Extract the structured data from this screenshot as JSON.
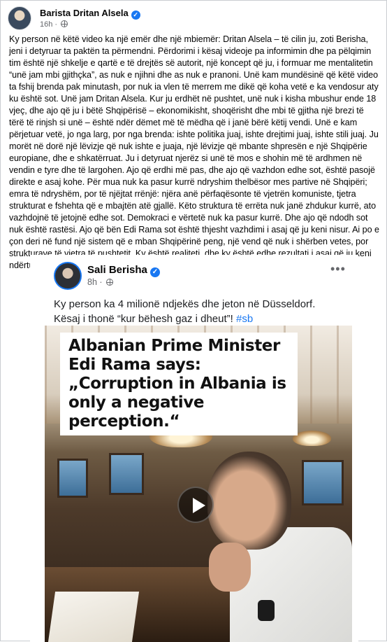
{
  "post": {
    "author": "Barista Dritan Alsela",
    "time": "16h",
    "separator": "·",
    "text": "Ky person në këtë video ka një emër dhe një mbiemër: Dritan Alsela – të cilin ju, zoti Berisha, jeni i detyruar ta paktën ta përmendni. Përdorimi i kësaj videoje pa informimin dhe pa pëlqimin tim është një shkelje e qartë e të drejtës së autorit, një koncept që ju, i formuar me mentalitetin “unë jam mbi gjithçka”, as nuk e njihni dhe as nuk e pranoni. Unë kam mundësinë që këtë video ta fshij brenda pak minutash, por nuk ia vlen të merrem me dikë që koha vetë e ka vendosur aty ku është sot. Unë jam Dritan Alsela. Kur ju erdhët në pushtet, unë nuk i kisha mbushur ende 18 vjeç, dhe ajo që ju i bëtë Shqipërisë – ekonomikisht, shoqërisht dhe mbi të gjitha një brezi të tërë të rinjsh si unë – është ndër dëmet më të mëdha që i janë bërë këtij vendi. Unë e kam përjetuar vetë, jo nga larg, por nga brenda: ishte politika juaj, ishte drejtimi juaj, ishte stili juaj. Ju morët në dorë një lëvizje që nuk ishte e juaja, një lëvizje që mbante shpresën e një Shqipërie europiane, dhe e shkatërruat. Ju i detyruat njerëz si unë të mos e shohin më të ardhmen në vendin e tyre dhe të largohen. Ajo që erdhi më pas, dhe ajo që vazhdon edhe sot, është pasojë direkte e asaj kohe. Për mua nuk ka pasur kurrë ndryshim thelbësor mes partive në Shqipëri; emra të ndryshëm, por të njëjtat rrënjë: njëra anë përfaqësonte të vjetrën komuniste, tjetra strukturat e fshehta që e mbajtën atë gjallë. Këto struktura të errëta nuk janë zhdukur kurrë, ato vazhdojnë të jetojnë edhe sot. Demokraci e vërtetë nuk ka pasur kurrë. Dhe ajo që ndodh sot nuk është rastësi. Ajo që bën Edi Rama sot është thjesht vazhdimi i asaj që ju keni nisur. Ai po e çon deri në fund një sistem që e mban Shqipërinë peng, një vend që nuk i shërben vetes, por strukturave të vjetra të pushtetit. Ky është realiteti, dhe ky është edhe rezultati i asaj që ju keni ndërtuar."
  },
  "shared": {
    "author": "Sali Berisha",
    "time": "8h",
    "separator": "·",
    "more": "•••",
    "text_line1": "Ky person ka 4 milionë ndjekës dhe jeton në Düsseldorf.",
    "text_line2": "Kësaj i thonë “kur bëhesh gaz i dheut”! ",
    "hashtag": "#sb",
    "video_caption": "Albanian Prime Minister Edi Rama says: „Corruption in Albania is only a negative perception.“"
  },
  "icons": {
    "verified": "verified-badge-icon",
    "privacy": "globe-icon",
    "play": "play-icon",
    "more": "more-options-icon"
  },
  "colors": {
    "accent": "#1877f2",
    "meta_text": "#65676b"
  }
}
